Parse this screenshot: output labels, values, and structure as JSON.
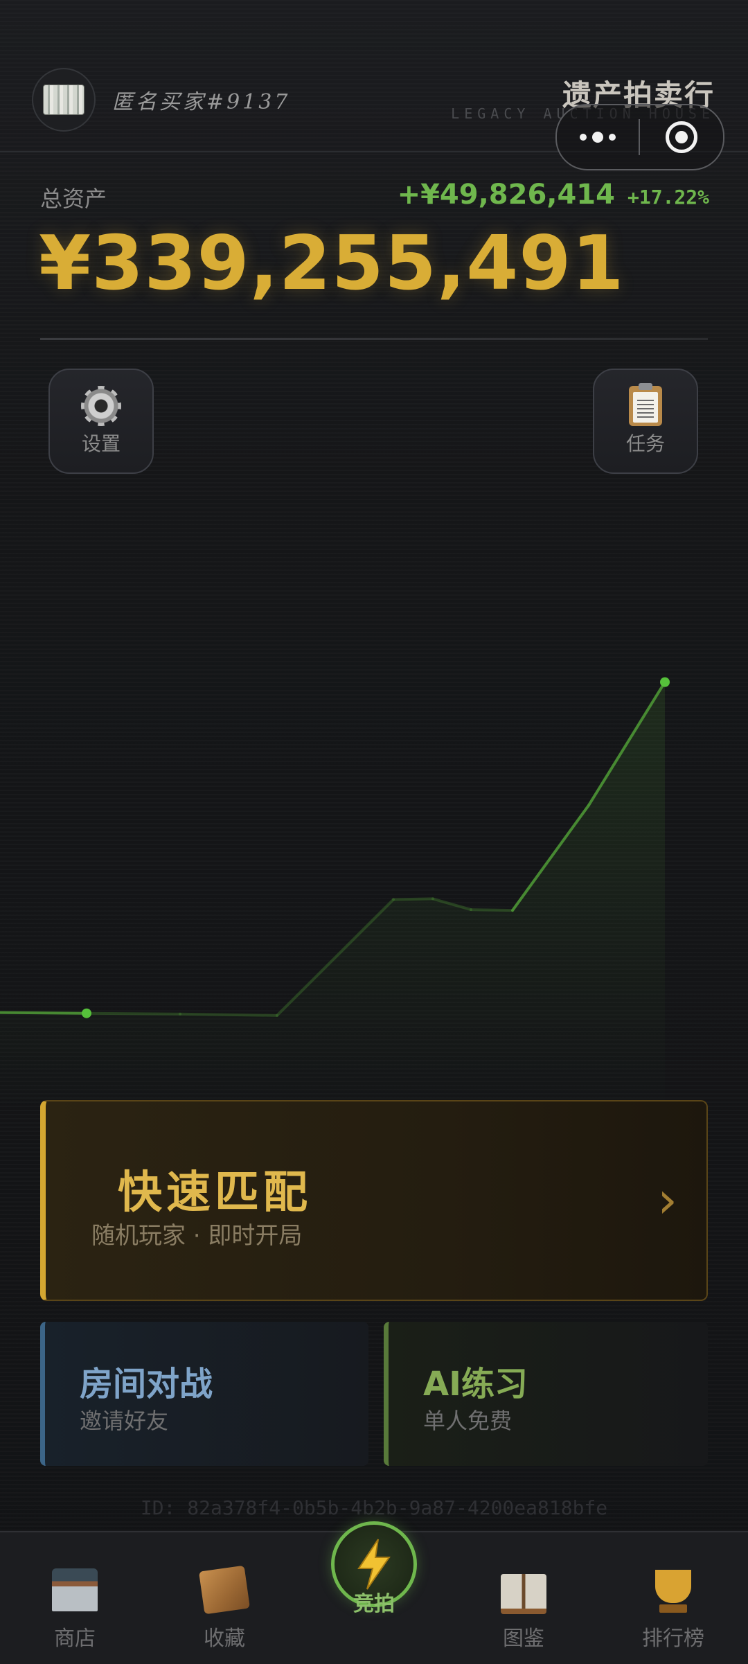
{
  "header": {
    "username": "匿名买家#9137",
    "brand_title": "遗产拍卖行",
    "brand_subtitle": "LEGACY AUCTION HOUSE"
  },
  "assets": {
    "label": "总资产",
    "total": "¥339,255,491",
    "change_amount": "+¥49,826,414",
    "change_percent": "+17.22%"
  },
  "buttons": {
    "settings_label": "设置",
    "tasks_label": "任务"
  },
  "chart_data": {
    "type": "line",
    "title": "",
    "xlabel": "",
    "ylabel": "",
    "series": [
      {
        "values": [
          289400000,
          289300000,
          289200000,
          289000000,
          305000000,
          305100000,
          303600000,
          303500000,
          318000000,
          335000000
        ]
      }
    ],
    "highlight_points": [
      1,
      9
    ],
    "line_color": "#4a8f34",
    "point_color": "#56c13b",
    "ylim": [
      280000000,
      345000000
    ]
  },
  "quick_match": {
    "title": "快速匹配",
    "subtitle": "随机玩家 · 即时开局",
    "arrow": "›"
  },
  "modes": {
    "room": {
      "title": "房间对战",
      "subtitle": "邀请好友"
    },
    "ai": {
      "title": "AI练习",
      "subtitle": "单人免费"
    }
  },
  "user_id": "ID: 82a378f4-0b5b-4b2b-9a87-4200ea818bfe",
  "nav": {
    "items": [
      {
        "label": "商店",
        "icon": "store-icon"
      },
      {
        "label": "收藏",
        "icon": "box-icon"
      },
      {
        "label": "竞拍",
        "icon": "lightning-icon",
        "active": true
      },
      {
        "label": "图鉴",
        "icon": "book-icon"
      },
      {
        "label": "排行榜",
        "icon": "trophy-icon"
      }
    ]
  },
  "colors": {
    "gold": "#d9ad36",
    "green": "#6fb74d",
    "blue": "#7fa4c9"
  }
}
